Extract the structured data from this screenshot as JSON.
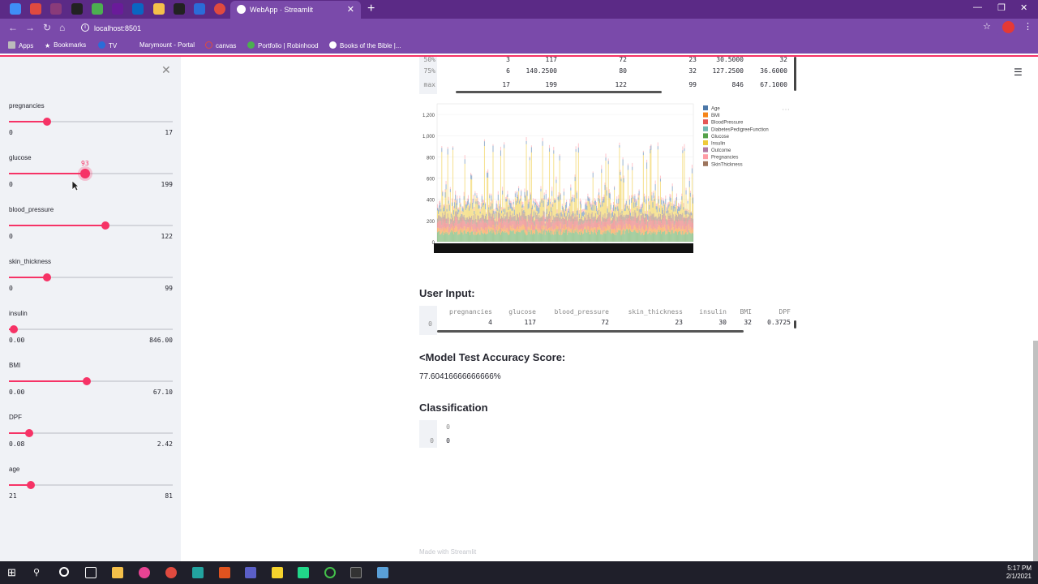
{
  "browser": {
    "active_tab_title": "WebApp · Streamlit",
    "url": "localhost:8501",
    "bookmarks": [
      "Apps",
      "Bookmarks",
      "TV",
      "Marymount - Portal",
      "canvas",
      "Portfolio | Robinhood",
      "Books of the Bible |..."
    ],
    "accent": "#7a4aaa"
  },
  "sidebar": {
    "sliders": [
      {
        "label": "pregnancies",
        "min": "0",
        "max": "17",
        "fraction": 0.235
      },
      {
        "label": "glucose",
        "min": "0",
        "max": "199",
        "fraction": 0.467,
        "current": "93"
      },
      {
        "label": "blood_pressure",
        "min": "0",
        "max": "122",
        "fraction": 0.59
      },
      {
        "label": "skin_thickness",
        "min": "0",
        "max": "99",
        "fraction": 0.232
      },
      {
        "label": "insulin",
        "min": "0.00",
        "max": "846.00",
        "fraction": 0.03
      },
      {
        "label": "BMI",
        "min": "0.00",
        "max": "67.10",
        "fraction": 0.477
      },
      {
        "label": "DPF",
        "min": "0.08",
        "max": "2.42",
        "fraction": 0.125
      },
      {
        "label": "age",
        "min": "21",
        "max": "81",
        "fraction": 0.133
      }
    ]
  },
  "describe_table": {
    "rows": [
      {
        "idx": "50%",
        "cells": [
          "3",
          "117",
          "72",
          "23",
          "30.5000",
          "32"
        ]
      },
      {
        "idx": "75%",
        "cells": [
          "6",
          "140.2500",
          "80",
          "32",
          "127.2500",
          "36.6000"
        ]
      },
      {
        "idx": "max",
        "cells": [
          "17",
          "199",
          "122",
          "99",
          "846",
          "67.1000"
        ]
      }
    ]
  },
  "chart_data": {
    "type": "bar",
    "y_ticks": [
      "1,200",
      "1,000",
      "800",
      "600",
      "400",
      "200",
      "0"
    ],
    "ylim": [
      0,
      1300
    ],
    "legend": [
      "Age",
      "BMI",
      "BloodPressure",
      "DiabetesPedigreeFunction",
      "Glucose",
      "Insulin",
      "Outcome",
      "Pregnancies",
      "SkinThickness"
    ],
    "legend_colors": [
      "#4c78a8",
      "#f58518",
      "#e45756",
      "#72b7b2",
      "#54a24b",
      "#eeca3b",
      "#b279a2",
      "#ff9da6",
      "#9d755d"
    ],
    "legend_position": "right"
  },
  "user_input": {
    "heading": "User Input:",
    "columns": [
      "pregnancies",
      "glucose",
      "blood_pressure",
      "skin_thickness",
      "insulin",
      "BMI",
      "DPF"
    ],
    "row_index": "0",
    "values": [
      "4",
      "117",
      "72",
      "23",
      "30",
      "32",
      "0.3725"
    ]
  },
  "accuracy": {
    "heading": "<Model Test Accuracy Score:",
    "value": "77.60416666666666%"
  },
  "classification": {
    "heading": "Classification",
    "column": "0",
    "row_index": "0",
    "value": "0"
  },
  "footer": "Made with Streamlit",
  "taskbar": {
    "time": "5:17 PM",
    "date": "2/1/2021"
  }
}
